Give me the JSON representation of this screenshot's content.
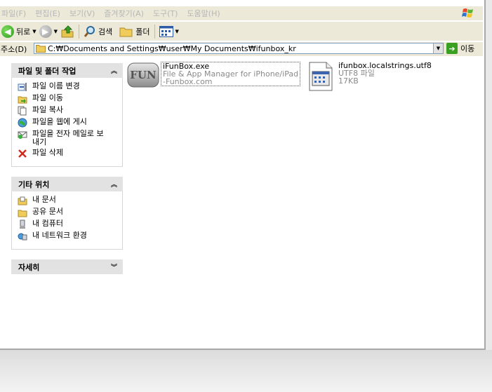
{
  "menu": {
    "items": [
      "파일(F)",
      "편집(E)",
      "보기(V)",
      "즐겨찾기(A)",
      "도구(T)",
      "도움말(H)"
    ]
  },
  "toolbar": {
    "back_label": "뒤로",
    "search_label": "검색",
    "folders_label": "폴더"
  },
  "address": {
    "label": "주소(D)",
    "path": "C:₩Documents and Settings₩user₩My Documents₩ifunbox_kr",
    "go_label": "이동"
  },
  "sidebar": {
    "file_tasks": {
      "title": "파일 및 폴더 작업",
      "items": [
        {
          "icon": "rename-icon",
          "label": "파일 이름 변경"
        },
        {
          "icon": "move-icon",
          "label": "파일 이동"
        },
        {
          "icon": "copy-icon",
          "label": "파일 복사"
        },
        {
          "icon": "web-publish-icon",
          "label": "파일을 웹에 게시"
        },
        {
          "icon": "email-icon",
          "label": "파일을 전자 메일로 보\n내기"
        },
        {
          "icon": "delete-icon",
          "label": "파일 삭제"
        }
      ]
    },
    "other_places": {
      "title": "기타 위치",
      "items": [
        {
          "icon": "my-documents-icon",
          "label": "내 문서"
        },
        {
          "icon": "shared-documents-icon",
          "label": "공유 문서"
        },
        {
          "icon": "my-computer-icon",
          "label": "내 컴퓨터"
        },
        {
          "icon": "network-places-icon",
          "label": "내 네트워크 환경"
        }
      ]
    },
    "details": {
      "title": "자세히"
    }
  },
  "files": [
    {
      "name": "iFunBox.exe",
      "line2": "File & App Manager for iPhone/iPad",
      "line3": "-Funbox.com",
      "icon_text": "FUN"
    },
    {
      "name": "ifunbox.localstrings.utf8",
      "line2": "UTF8 파일",
      "line3": "17KB"
    }
  ]
}
